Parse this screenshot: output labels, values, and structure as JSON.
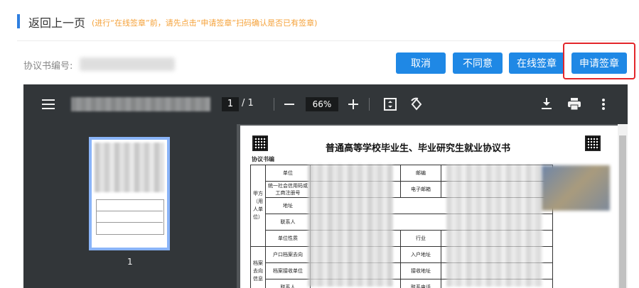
{
  "header": {
    "title": "返回上一页",
    "note": "(进行“在线签章”前，请先点击“申请签章”扫码确认是否已有签章)"
  },
  "agreement": {
    "label": "协议书编号:"
  },
  "buttons": {
    "cancel": "取消",
    "disagree": "不同意",
    "online_sign": "在线签章",
    "apply_sign": "申请签章"
  },
  "viewer": {
    "page_current": "1",
    "page_total": "/ 1",
    "zoom": "66%",
    "thumb_label": "1",
    "icons": [
      "menu-icon",
      "zoom-out-icon",
      "zoom-in-icon",
      "fit-page-icon",
      "rotate-icon",
      "download-icon",
      "print-icon",
      "more-icon"
    ]
  },
  "document": {
    "title": "普通高等学校毕业生、毕业研究生就业协议书",
    "agreement_no_label": "协议书编",
    "section_a": "甲方（用人单位）",
    "section_b": "档案去向信息",
    "rows": [
      {
        "left": "单位",
        "right": "邮编"
      },
      {
        "left": "统一社会信用码或工商注册号",
        "right": "电子邮箱"
      },
      {
        "left": "地址",
        "right": ""
      },
      {
        "left": "联系人",
        "right": ""
      },
      {
        "left": "单位性质",
        "right": "行业"
      },
      {
        "left": "户口档案去向",
        "right": "入户地址"
      },
      {
        "left": "档案接收单位",
        "right": "接收地址"
      },
      {
        "left": "联系人",
        "right": "联系电话"
      }
    ]
  },
  "colors": {
    "accent": "#1f88e5",
    "note": "#f5a23a",
    "highlight": "#e3262a"
  }
}
